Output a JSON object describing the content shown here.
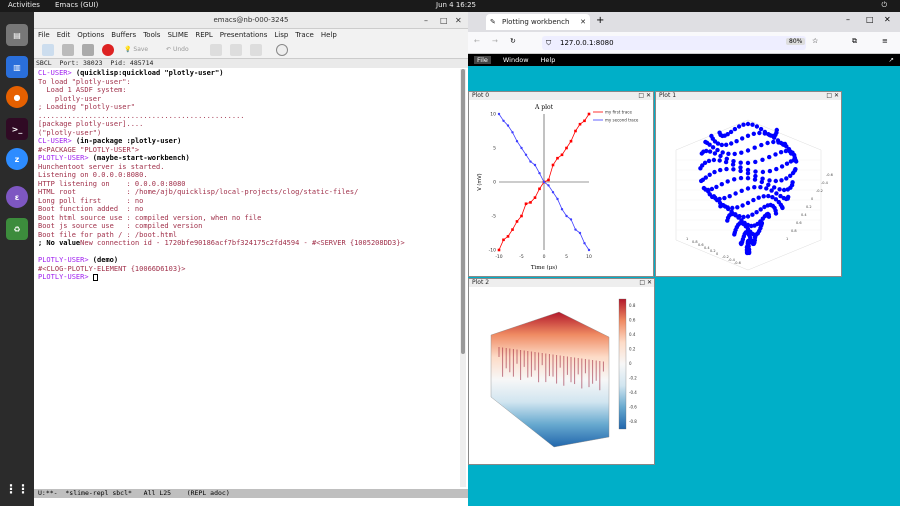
{
  "topbar": {
    "activities": "Activities",
    "app": "Emacs (GUI)",
    "clock": "Jun 4  16:25"
  },
  "emacs": {
    "title": "emacs@nb-000-3245",
    "menu": [
      "File",
      "Edit",
      "Options",
      "Buffers",
      "Tools",
      "SLIME",
      "REPL",
      "Presentations",
      "Lisp",
      "Trace",
      "Help"
    ],
    "toolbar": {
      "save": "Save",
      "undo": "Undo"
    },
    "status": "SBCL  Port: 38023  Pid: 485714",
    "lines": [
      {
        "c": "prompt",
        "t": "CL-USER> ",
        "k": "cmd",
        "v": "(quicklisp:quickload \"plotly-user\")"
      },
      {
        "c": "out",
        "t": "To load \"plotly-user\":"
      },
      {
        "c": "out",
        "t": "  Load 1 ASDF system:"
      },
      {
        "c": "out",
        "t": "    plotly-user"
      },
      {
        "c": "out",
        "t": "; Loading \"plotly-user\""
      },
      {
        "c": "out",
        "t": "................................................."
      },
      {
        "c": "out",
        "t": "[package plotly-user]...."
      },
      {
        "c": "out",
        "t": "(\"plotly-user\")"
      },
      {
        "c": "prompt",
        "t": "CL-USER> ",
        "k": "cmd",
        "v": "(in-package :plotly-user)"
      },
      {
        "c": "out",
        "t": "#<PACKAGE \"PLOTLY-USER\">"
      },
      {
        "c": "prompt",
        "t": "PLOTLY-USER> ",
        "k": "cmd",
        "v": "(maybe-start-workbench)"
      },
      {
        "c": "out",
        "t": "Hunchentoot server is started."
      },
      {
        "c": "out",
        "t": "Listening on 0.0.0.0:8080."
      },
      {
        "c": "out",
        "t": "HTTP listening on    : 0.0.0.0:8080"
      },
      {
        "c": "out",
        "t": "HTML root            : /home/ajb/quicklisp/local-projects/clog/static-files/"
      },
      {
        "c": "out",
        "t": "Long poll first      : no"
      },
      {
        "c": "out",
        "t": "Boot function added  : no"
      },
      {
        "c": "out",
        "t": "Boot html source use : compiled version, when no file"
      },
      {
        "c": "out",
        "t": "Boot js source use   : compiled version"
      },
      {
        "c": "out",
        "t": "Boot file for path / : /boot.html"
      },
      {
        "c": "cmd",
        "t": "; No value",
        "k": "out",
        "v": "New connection id - 1720bfe90186acf7bf324175c2fd4594 - #<SERVER {1005208DD3}>"
      },
      {
        "c": "out",
        "t": " "
      },
      {
        "c": "prompt",
        "t": "PLOTLY-USER> ",
        "k": "cmd",
        "v": "(demo)"
      },
      {
        "c": "out",
        "t": "#<CLOG-PLOTLY-ELEMENT {10066D6103}>"
      },
      {
        "c": "prompt",
        "t": "PLOTLY-USER> ",
        "k": "cmd",
        "v": ""
      }
    ],
    "modeline": "U:**-  *slime-repl sbcl*   All L25    (REPL adoc)"
  },
  "browser": {
    "tab_title": "Plotting workbench",
    "url": "127.0.0.1:8080",
    "zoom": "80%",
    "menu": [
      "File",
      "Window",
      "Help"
    ],
    "plots": [
      {
        "title": "Plot 0"
      },
      {
        "title": "Plot 1"
      },
      {
        "title": "Plot 2"
      }
    ]
  },
  "chart_data": [
    {
      "type": "line",
      "title": "A plot",
      "xlabel": "Time (μs)",
      "ylabel": "V (mV)",
      "xlim": [
        -10,
        10
      ],
      "ylim": [
        -10,
        10
      ],
      "xticks": [
        "-10",
        "-5",
        "0",
        "5",
        "10"
      ],
      "yticks": [
        "10",
        "5",
        "0",
        "-5",
        "-10"
      ],
      "legend": "top-right",
      "series": [
        {
          "name": "my first trace",
          "color": "#ff0000",
          "x": [
            -10,
            -9,
            -8,
            -7,
            -6,
            -5,
            -4,
            -3,
            -2,
            -1,
            0,
            1,
            2,
            3,
            4,
            5,
            6,
            7,
            8,
            9,
            10
          ],
          "y": [
            -10,
            -8.5,
            -8,
            -7,
            -5.8,
            -5,
            -3.2,
            -3,
            -2.3,
            -1,
            0,
            0.3,
            2.5,
            3.5,
            4,
            5,
            6,
            7.5,
            8.5,
            9,
            10
          ]
        },
        {
          "name": "my second trace",
          "color": "#4040ff",
          "x": [
            -10,
            -9,
            -8,
            -7,
            -6,
            -5,
            -4,
            -3,
            -2,
            -1,
            0,
            1,
            2,
            3,
            4,
            5,
            6,
            7,
            8,
            9,
            10
          ],
          "y": [
            10,
            9,
            8.3,
            7.3,
            6,
            5,
            4,
            3,
            2.5,
            1.3,
            0,
            -0.5,
            -1.5,
            -2.5,
            -4,
            -5,
            -5.5,
            -7,
            -7.5,
            -9,
            -10
          ]
        }
      ]
    },
    {
      "type": "scatter",
      "title": "",
      "ticks": [
        "1",
        "0.8",
        "0.6",
        "0.4",
        "0.2",
        "0",
        "-0.2",
        "-0.4",
        "-0.6"
      ],
      "color": "#0000ff"
    },
    {
      "type": "heatmap",
      "title": "",
      "colorbar_ticks": [
        "0.8",
        "0.6",
        "0.4",
        "0.2",
        "0",
        "-0.2",
        "-0.4",
        "-0.6",
        "-0.8"
      ],
      "colorscale": [
        "#b2182b",
        "#ef8a62",
        "#fddbc7",
        "#f7f7f7",
        "#d1e5f0",
        "#67a9cf",
        "#2166ac"
      ]
    }
  ]
}
